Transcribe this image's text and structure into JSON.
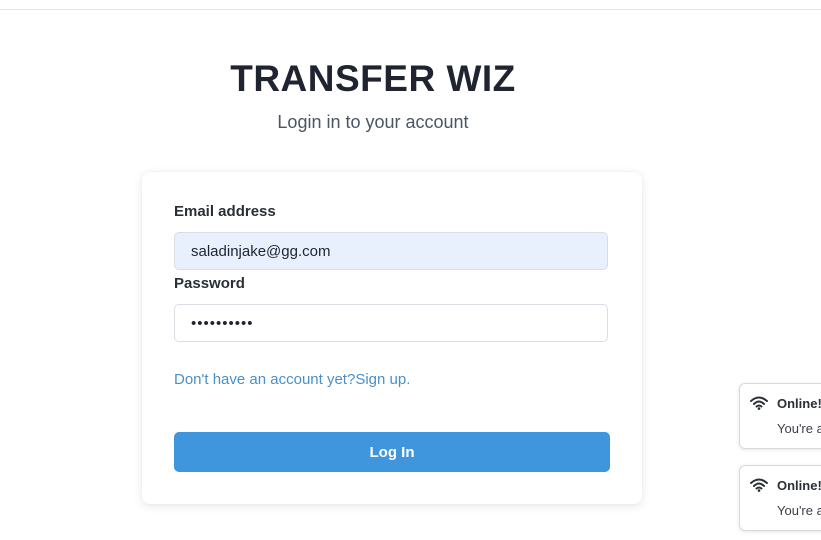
{
  "header": {
    "app_title": "TRANSFER WIZ",
    "subtitle": "Login in to your account"
  },
  "form": {
    "email_label": "Email address",
    "email_value": "saladinjake@gg.com",
    "password_label": "Password",
    "password_mask": "••••••••••",
    "signup_link": "Don't have an account yet?Sign up.",
    "login_button": "Log In"
  },
  "toasts": [
    {
      "icon": "wifi-icon",
      "title": "Online!",
      "body": "You're a"
    },
    {
      "icon": "wifi-icon",
      "title": "Online!",
      "body": "You're a"
    }
  ],
  "colors": {
    "primary_button": "#4096dd",
    "link": "#4a90c8",
    "autofill_background": "#e8f0fe",
    "title_text": "#1f2430"
  }
}
